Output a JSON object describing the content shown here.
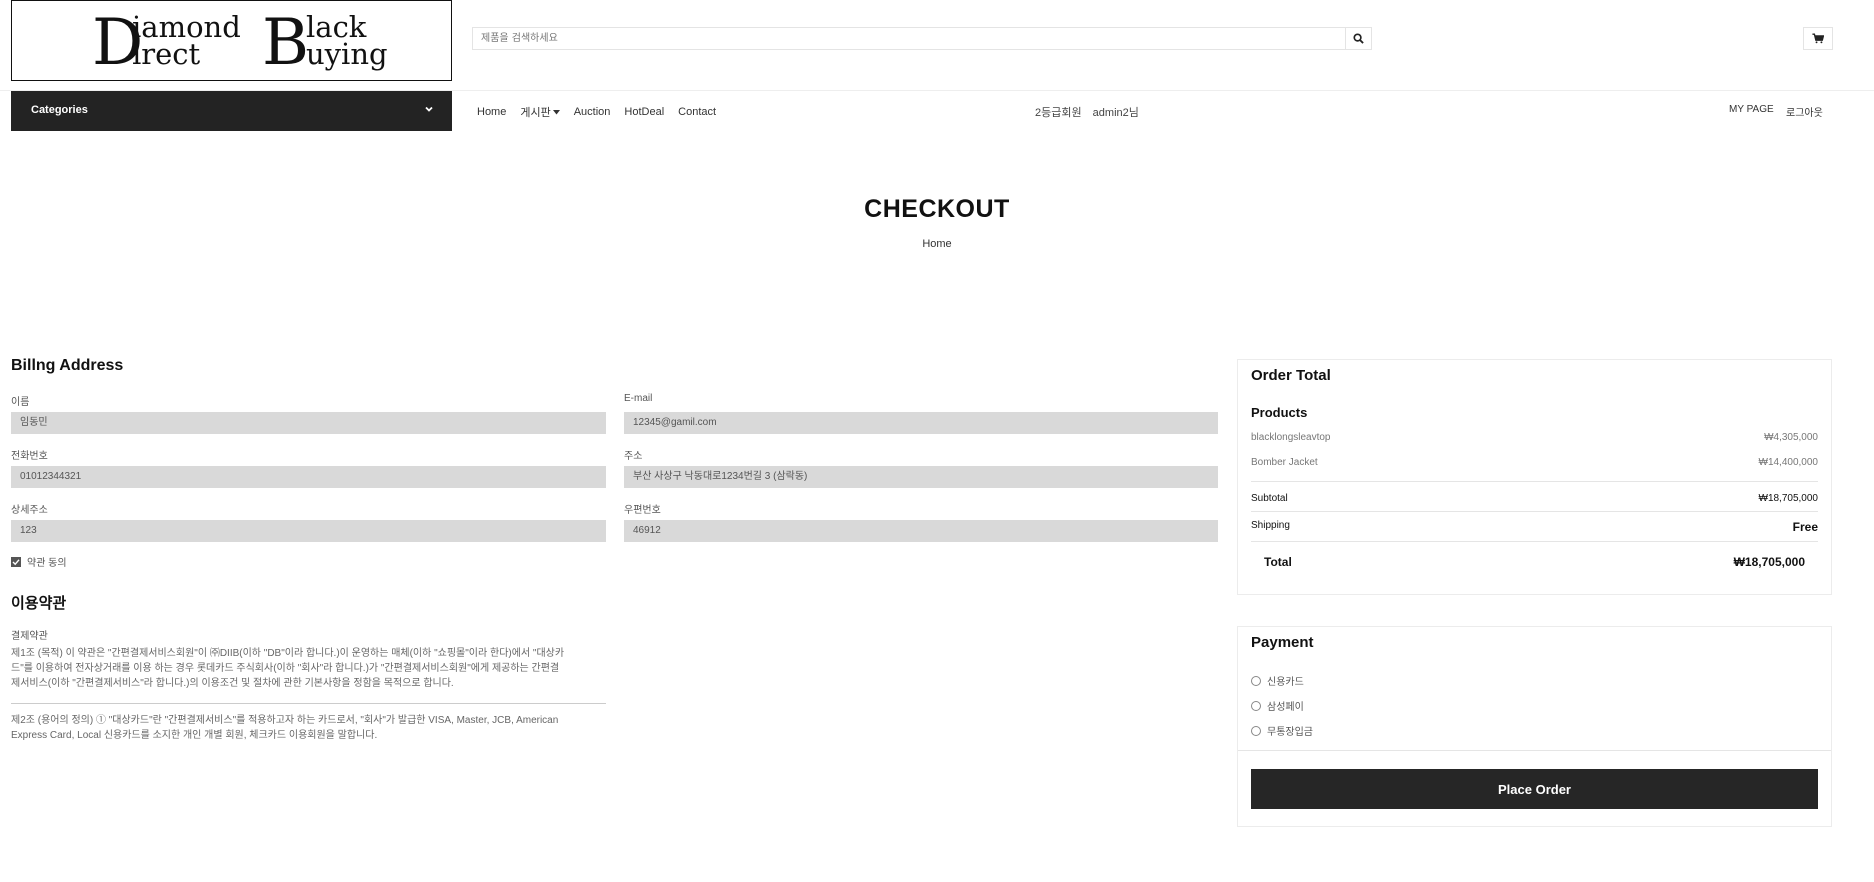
{
  "logo": {
    "line1_big1": "D",
    "line1_text1": "iamond",
    "line1_big2": "B",
    "line1_text2": "lack",
    "line2_text1": "irect",
    "line2_text2": "uying"
  },
  "search": {
    "placeholder": "제품을 검색하세요",
    "icon": "search-icon"
  },
  "cart": {
    "icon": "cart-icon"
  },
  "categories": {
    "label": "Categories",
    "icon": "chevron-down-icon"
  },
  "nav": {
    "items": [
      "Home",
      "게시판",
      "Auction",
      "HotDeal",
      "Contact"
    ]
  },
  "member": {
    "grade": "2등급회원",
    "name": "admin2님"
  },
  "topright": {
    "mypage": "MY PAGE",
    "logout": "로그아웃"
  },
  "page": {
    "title": "CHECKOUT",
    "breadcrumb": "Home"
  },
  "billing": {
    "heading": "Billng Address",
    "name_label": "이름",
    "name_value": "임동민",
    "email_label": "E-mail",
    "email_value": "12345@gamil.com",
    "phone_label": "전화번호",
    "phone_value": "01012344321",
    "address_label": "주소",
    "address_value": "부산 사상구 낙동대로1234번길 3 (삼락동)",
    "detail_label": "상세주소",
    "detail_value": "123",
    "zip_label": "우편번호",
    "zip_value": "46912",
    "agree_label": "약관 동의",
    "agree_checked": true
  },
  "terms": {
    "heading": "이용약관",
    "sub": "결제약관",
    "p1_l1": "제1조 (목적) 이 약관은 \"간편결제서비스회원\"이 ㈜DIIB(이하 \"DB\"이라 합니다.)이 운영하는 매체(이하 \"쇼핑몰\"이라 한다)에서 \"대상카",
    "p1_l2": "드\"를 이용하여 전자상거래를 이용 하는 경우 롯데카드 주식회사(이하 \"회사\"라 합니다.)가 \"간편결제서비스회원\"에게 제공하는 간편결",
    "p1_l3": "제서비스(이하 \"간편결제서비스\"라 합니다.)의 이용조건 및 절차에 관한 기본사항을 정함을 목적으로 합니다.",
    "p2_l1": "제2조 (용어의 정의) ① \"대상카드\"란 \"간편결제서비스\"를 적용하고자 하는 카드로서, \"회사\"가 발급한 VISA, Master, JCB, American",
    "p2_l2": "Express Card, Local 신용카드를 소지한 개인 개별 회원, 체크카드 이용회원을 말합니다."
  },
  "order": {
    "heading": "Order Total",
    "products_label": "Products",
    "products": [
      {
        "name": "blacklongsleavtop",
        "price": "₩4,305,000"
      },
      {
        "name": "Bomber Jacket",
        "price": "₩14,400,000"
      }
    ],
    "subtotal_label": "Subtotal",
    "subtotal_value": "₩18,705,000",
    "shipping_label": "Shipping",
    "shipping_value": "Free",
    "total_label": "Total",
    "total_value": "₩18,705,000"
  },
  "payment": {
    "heading": "Payment",
    "options": [
      "신용카드",
      "삼성페이",
      "무통장입금"
    ],
    "place_order": "Place Order"
  }
}
